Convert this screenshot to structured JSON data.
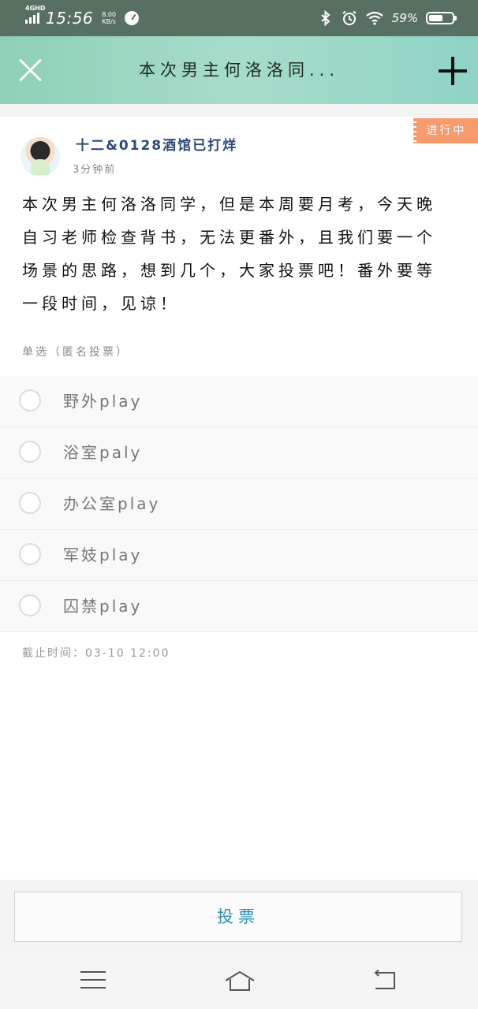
{
  "status_bar": {
    "network": "4GHD",
    "time": "15:56",
    "speed_value": "8.00",
    "speed_unit": "KB/s",
    "battery": "59%",
    "battery_level": 0.59
  },
  "header": {
    "title": "本次男主何洛洛同..."
  },
  "post": {
    "status": "进行中",
    "author": "十二&0128酒馆已打烊",
    "time_ago": "3分钟前",
    "body": "本次男主何洛洛同学，但是本周要月考，今天晚自习老师检查背书，无法更番外，且我们要一个场景的思路，想到几个，大家投票吧！番外要等一段时间，见谅！",
    "vote_type": "单选（匿名投票）",
    "options": [
      {
        "label": "野外play"
      },
      {
        "label": "浴室paly"
      },
      {
        "label": "办公室play"
      },
      {
        "label": "军妓play"
      },
      {
        "label": "囚禁play"
      }
    ],
    "deadline": "截止时间：03-10 12:00"
  },
  "footer": {
    "vote_button": "投票"
  },
  "colors": {
    "status_bar": "#587062",
    "header_gradient_start": "#8ed0b6",
    "status_tag": "#f79a6c",
    "author": "#2f4a7a",
    "vote_button_text": "#2d8fb5"
  },
  "icons": [
    "signal-icon",
    "speed-gauge-icon",
    "bluetooth-icon",
    "alarm-icon",
    "wifi-icon",
    "battery-icon",
    "close-icon",
    "plus-icon",
    "menu-icon",
    "home-icon",
    "back-icon"
  ]
}
